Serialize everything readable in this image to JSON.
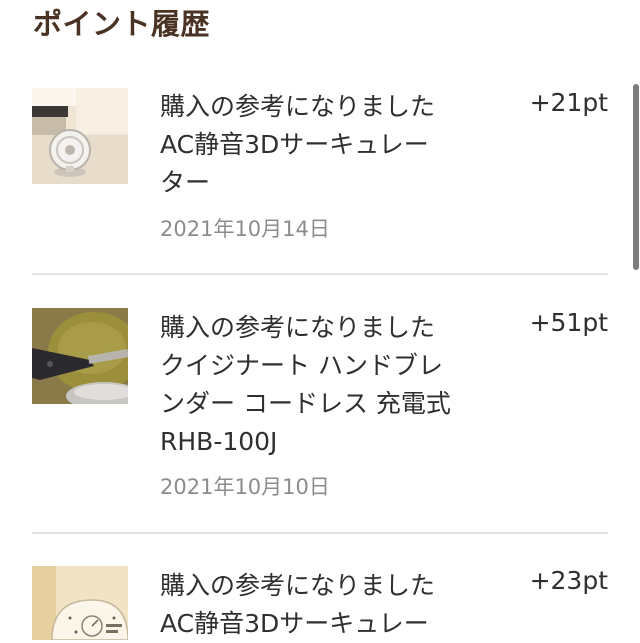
{
  "page": {
    "title": "ポイント履歴"
  },
  "history": [
    {
      "description_lines": [
        "購入の参考になりました",
        "AC静音3Dサーキュレー",
        "ター"
      ],
      "date": "2021年10月14日",
      "points": "+21pt",
      "thumbnail_icon": "circulator-fan-icon"
    },
    {
      "description_lines": [
        "購入の参考になりました",
        "クイジナート ハンドブレ",
        "ンダー コードレス 充電式",
        "RHB-100J"
      ],
      "date": "2021年10月10日",
      "points": "+51pt",
      "thumbnail_icon": "hand-blender-icon"
    },
    {
      "description_lines": [
        "購入の参考になりました",
        "AC静音3Dサーキュレー"
      ],
      "points": "+23pt",
      "thumbnail_icon": "circulator-dial-icon"
    }
  ],
  "colors": {
    "title": "#4a3224",
    "text": "#2f2f2f",
    "date": "#8c8c8c",
    "divider": "#e2e2e2",
    "scrollbar": "#7d7d7d"
  }
}
